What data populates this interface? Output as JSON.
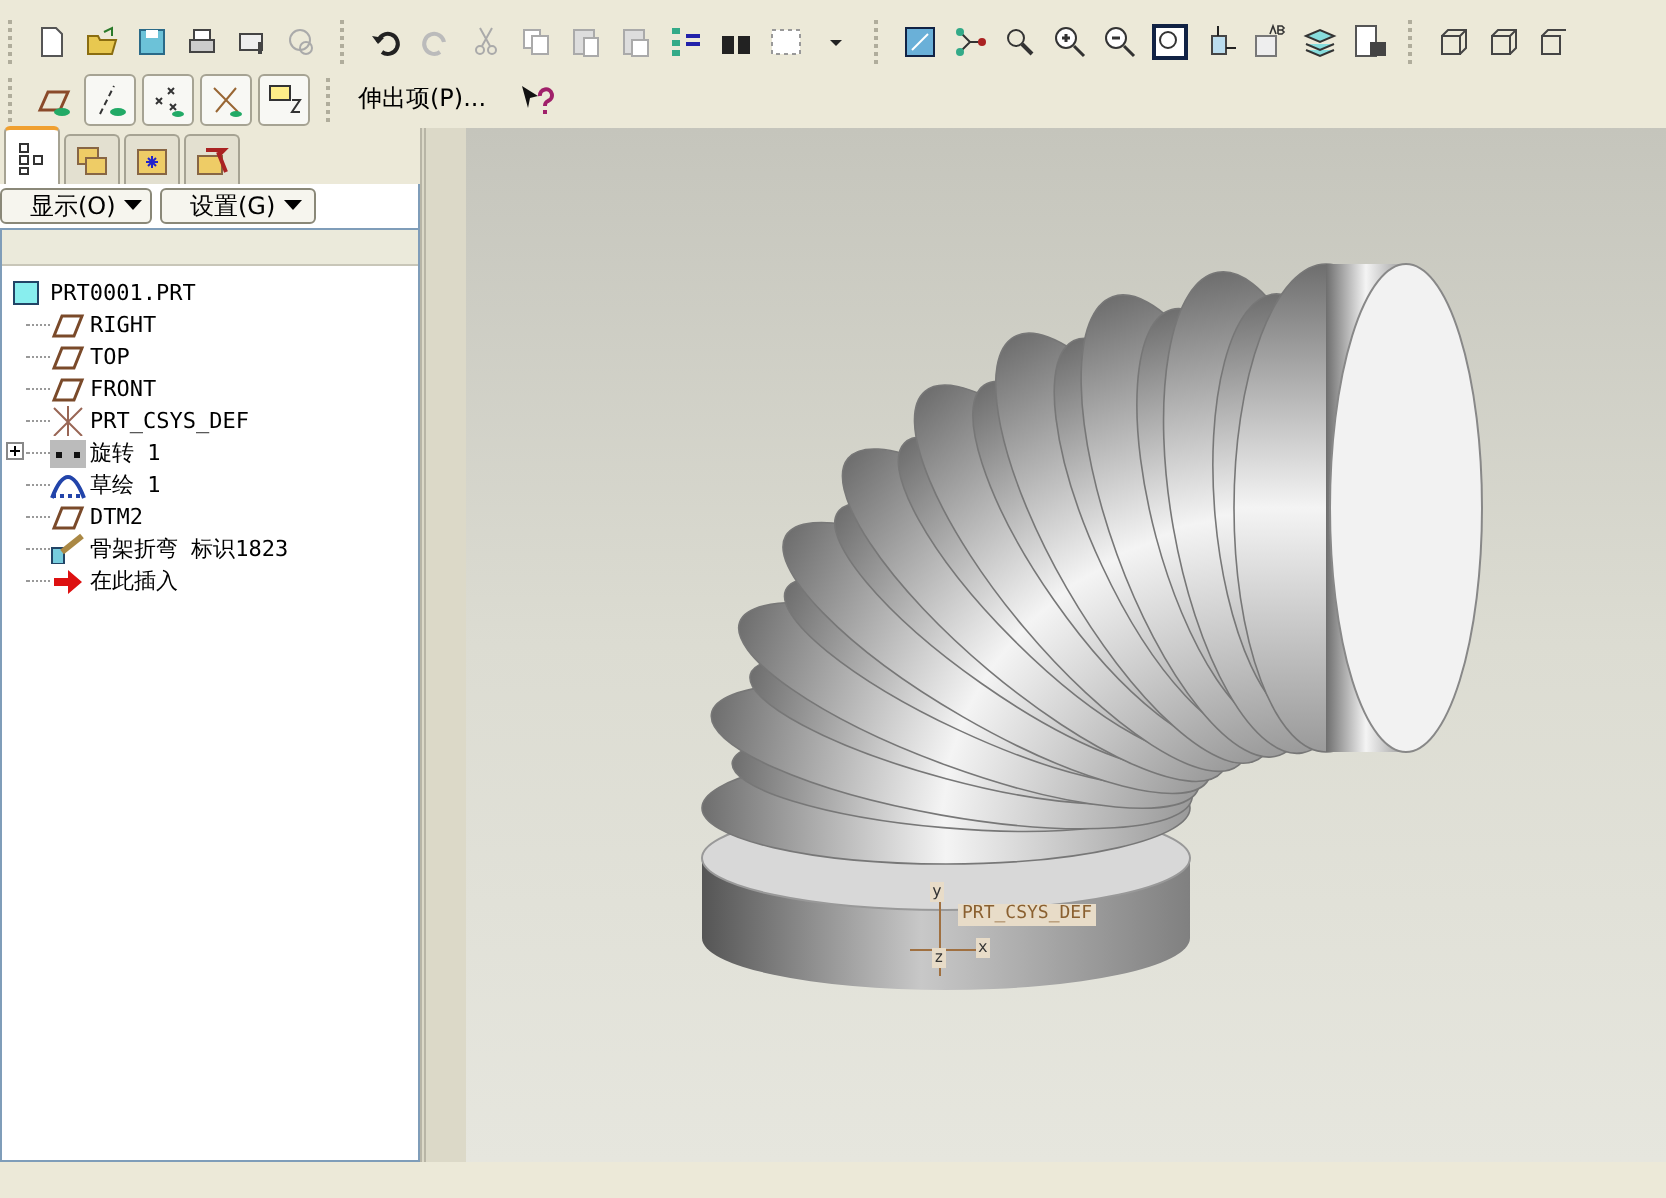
{
  "toolbar": {
    "command_label": "伸出项(P)..."
  },
  "model_tree": {
    "tabs": [
      {
        "kind": "tree",
        "selected": true
      },
      {
        "kind": "folders",
        "selected": false
      },
      {
        "kind": "favorites",
        "selected": false
      },
      {
        "kind": "tools",
        "selected": false
      }
    ],
    "menus": [
      "显示(O)",
      "设置(G)"
    ],
    "root": {
      "label": "PRT0001.PRT",
      "kind": "part",
      "children": [
        {
          "label": "RIGHT",
          "kind": "plane"
        },
        {
          "label": "TOP",
          "kind": "plane"
        },
        {
          "label": "FRONT",
          "kind": "plane"
        },
        {
          "label": "PRT_CSYS_DEF",
          "kind": "csys"
        },
        {
          "label": "旋转 1",
          "kind": "revolve",
          "expanded": false
        },
        {
          "label": "草绘 1",
          "kind": "sketch"
        },
        {
          "label": "DTM2",
          "kind": "plane"
        },
        {
          "label": "骨架折弯 标识1823",
          "kind": "bend"
        },
        {
          "label": "在此插入",
          "kind": "insert"
        }
      ]
    }
  },
  "viewport": {
    "csys_label": "PRT_CSYS_DEF",
    "axes": [
      "y",
      "x",
      "z"
    ]
  }
}
